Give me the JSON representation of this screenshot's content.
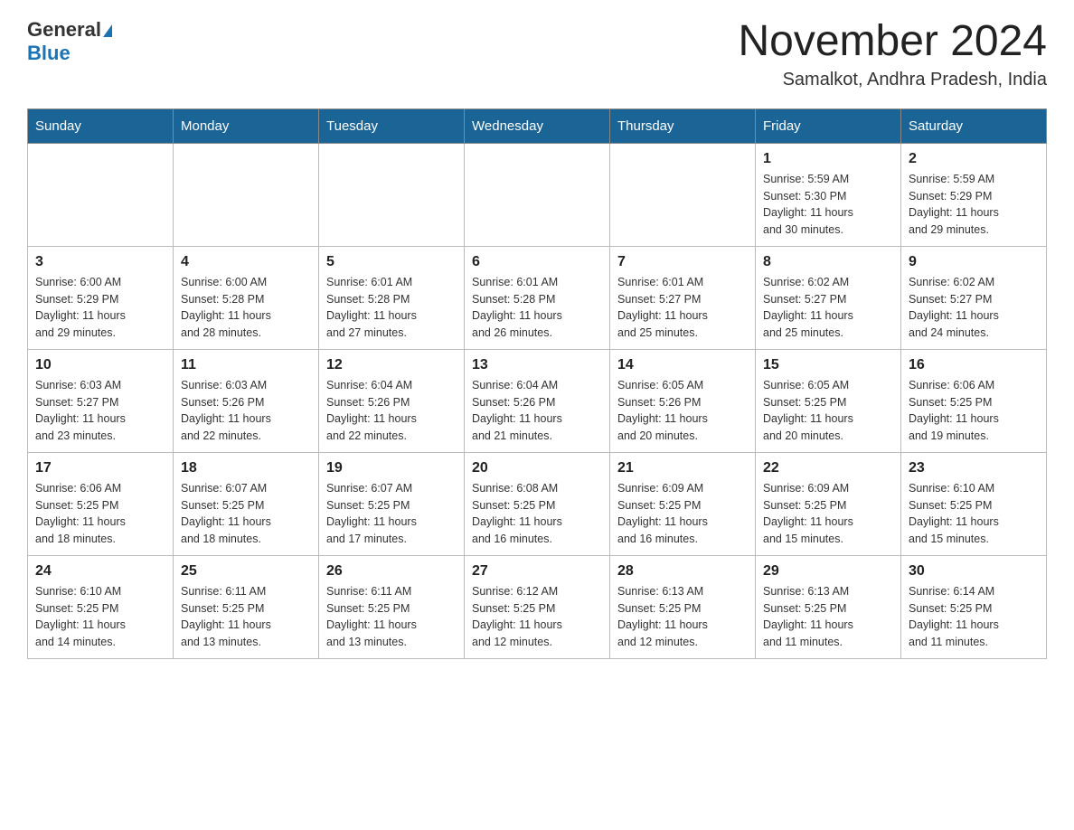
{
  "header": {
    "logo": {
      "general": "General",
      "blue": "Blue"
    },
    "title": "November 2024",
    "location": "Samalkot, Andhra Pradesh, India"
  },
  "days_of_week": [
    "Sunday",
    "Monday",
    "Tuesday",
    "Wednesday",
    "Thursday",
    "Friday",
    "Saturday"
  ],
  "weeks": [
    [
      {
        "day": "",
        "info": ""
      },
      {
        "day": "",
        "info": ""
      },
      {
        "day": "",
        "info": ""
      },
      {
        "day": "",
        "info": ""
      },
      {
        "day": "",
        "info": ""
      },
      {
        "day": "1",
        "info": "Sunrise: 5:59 AM\nSunset: 5:30 PM\nDaylight: 11 hours\nand 30 minutes."
      },
      {
        "day": "2",
        "info": "Sunrise: 5:59 AM\nSunset: 5:29 PM\nDaylight: 11 hours\nand 29 minutes."
      }
    ],
    [
      {
        "day": "3",
        "info": "Sunrise: 6:00 AM\nSunset: 5:29 PM\nDaylight: 11 hours\nand 29 minutes."
      },
      {
        "day": "4",
        "info": "Sunrise: 6:00 AM\nSunset: 5:28 PM\nDaylight: 11 hours\nand 28 minutes."
      },
      {
        "day": "5",
        "info": "Sunrise: 6:01 AM\nSunset: 5:28 PM\nDaylight: 11 hours\nand 27 minutes."
      },
      {
        "day": "6",
        "info": "Sunrise: 6:01 AM\nSunset: 5:28 PM\nDaylight: 11 hours\nand 26 minutes."
      },
      {
        "day": "7",
        "info": "Sunrise: 6:01 AM\nSunset: 5:27 PM\nDaylight: 11 hours\nand 25 minutes."
      },
      {
        "day": "8",
        "info": "Sunrise: 6:02 AM\nSunset: 5:27 PM\nDaylight: 11 hours\nand 25 minutes."
      },
      {
        "day": "9",
        "info": "Sunrise: 6:02 AM\nSunset: 5:27 PM\nDaylight: 11 hours\nand 24 minutes."
      }
    ],
    [
      {
        "day": "10",
        "info": "Sunrise: 6:03 AM\nSunset: 5:27 PM\nDaylight: 11 hours\nand 23 minutes."
      },
      {
        "day": "11",
        "info": "Sunrise: 6:03 AM\nSunset: 5:26 PM\nDaylight: 11 hours\nand 22 minutes."
      },
      {
        "day": "12",
        "info": "Sunrise: 6:04 AM\nSunset: 5:26 PM\nDaylight: 11 hours\nand 22 minutes."
      },
      {
        "day": "13",
        "info": "Sunrise: 6:04 AM\nSunset: 5:26 PM\nDaylight: 11 hours\nand 21 minutes."
      },
      {
        "day": "14",
        "info": "Sunrise: 6:05 AM\nSunset: 5:26 PM\nDaylight: 11 hours\nand 20 minutes."
      },
      {
        "day": "15",
        "info": "Sunrise: 6:05 AM\nSunset: 5:25 PM\nDaylight: 11 hours\nand 20 minutes."
      },
      {
        "day": "16",
        "info": "Sunrise: 6:06 AM\nSunset: 5:25 PM\nDaylight: 11 hours\nand 19 minutes."
      }
    ],
    [
      {
        "day": "17",
        "info": "Sunrise: 6:06 AM\nSunset: 5:25 PM\nDaylight: 11 hours\nand 18 minutes."
      },
      {
        "day": "18",
        "info": "Sunrise: 6:07 AM\nSunset: 5:25 PM\nDaylight: 11 hours\nand 18 minutes."
      },
      {
        "day": "19",
        "info": "Sunrise: 6:07 AM\nSunset: 5:25 PM\nDaylight: 11 hours\nand 17 minutes."
      },
      {
        "day": "20",
        "info": "Sunrise: 6:08 AM\nSunset: 5:25 PM\nDaylight: 11 hours\nand 16 minutes."
      },
      {
        "day": "21",
        "info": "Sunrise: 6:09 AM\nSunset: 5:25 PM\nDaylight: 11 hours\nand 16 minutes."
      },
      {
        "day": "22",
        "info": "Sunrise: 6:09 AM\nSunset: 5:25 PM\nDaylight: 11 hours\nand 15 minutes."
      },
      {
        "day": "23",
        "info": "Sunrise: 6:10 AM\nSunset: 5:25 PM\nDaylight: 11 hours\nand 15 minutes."
      }
    ],
    [
      {
        "day": "24",
        "info": "Sunrise: 6:10 AM\nSunset: 5:25 PM\nDaylight: 11 hours\nand 14 minutes."
      },
      {
        "day": "25",
        "info": "Sunrise: 6:11 AM\nSunset: 5:25 PM\nDaylight: 11 hours\nand 13 minutes."
      },
      {
        "day": "26",
        "info": "Sunrise: 6:11 AM\nSunset: 5:25 PM\nDaylight: 11 hours\nand 13 minutes."
      },
      {
        "day": "27",
        "info": "Sunrise: 6:12 AM\nSunset: 5:25 PM\nDaylight: 11 hours\nand 12 minutes."
      },
      {
        "day": "28",
        "info": "Sunrise: 6:13 AM\nSunset: 5:25 PM\nDaylight: 11 hours\nand 12 minutes."
      },
      {
        "day": "29",
        "info": "Sunrise: 6:13 AM\nSunset: 5:25 PM\nDaylight: 11 hours\nand 11 minutes."
      },
      {
        "day": "30",
        "info": "Sunrise: 6:14 AM\nSunset: 5:25 PM\nDaylight: 11 hours\nand 11 minutes."
      }
    ]
  ]
}
